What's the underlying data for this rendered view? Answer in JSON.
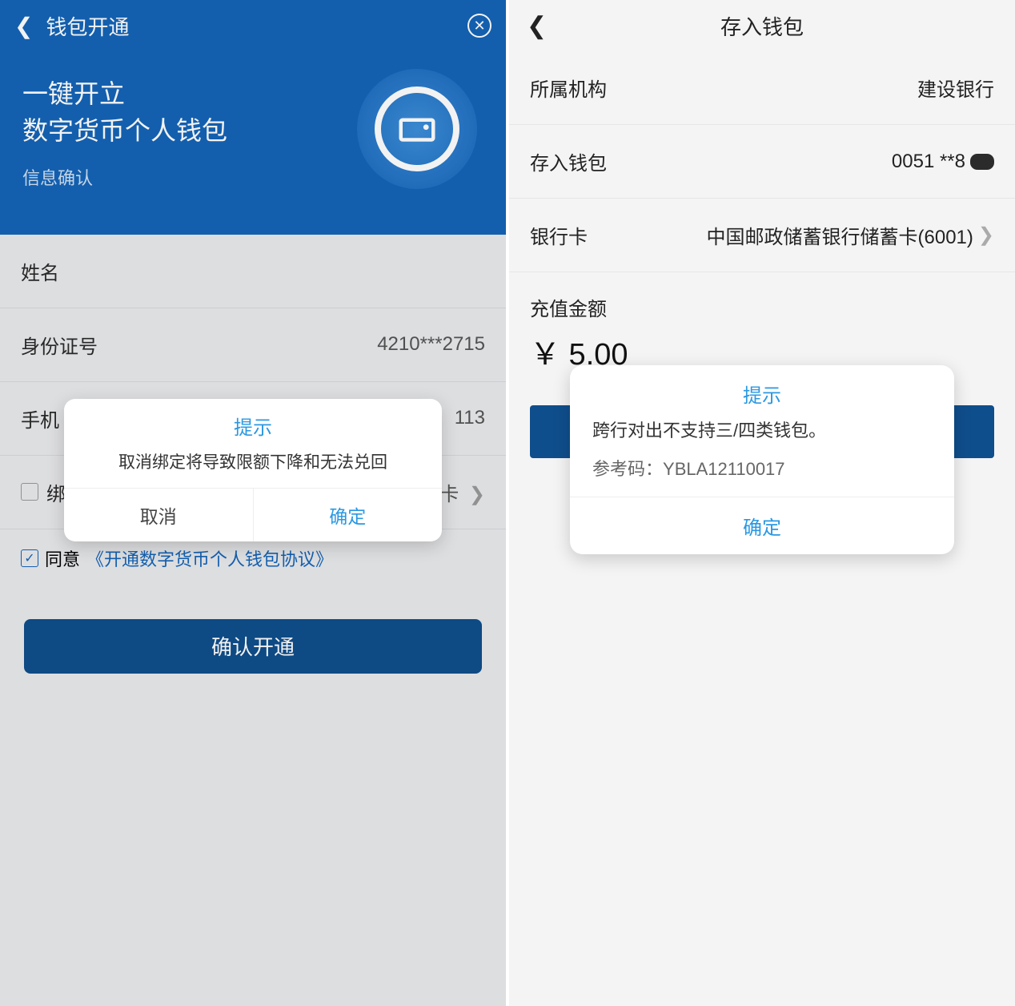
{
  "left": {
    "header": {
      "title": "钱包开通"
    },
    "hero": {
      "line1": "一键开立",
      "line2": "数字货币个人钱包",
      "sub": "信息确认"
    },
    "fields": {
      "name_label": "姓名",
      "id_label": "身份证号",
      "id_value": "4210***2715",
      "phone_label": "手机",
      "phone_value_suffix": "113",
      "bind_card_suffix": "卡",
      "checkbox_label": "同意",
      "agreement_link": "《开通数字货币个人钱包协议》"
    },
    "primary_button": "确认开通",
    "dialog": {
      "title": "提示",
      "message": "取消绑定将导致限额下降和无法兑回",
      "cancel": "取消",
      "ok": "确定"
    }
  },
  "right": {
    "header": {
      "title": "存入钱包"
    },
    "rows": {
      "org_label": "所属机构",
      "org_value": "建设银行",
      "wallet_label": "存入钱包",
      "wallet_value": "0051 **8",
      "bank_label": "银行卡",
      "bank_value": "中国邮政储蓄银行储蓄卡(6001)"
    },
    "amount_label": "充值金额",
    "amount_value": "￥ 5.00",
    "dialog": {
      "title": "提示",
      "message": "跨行对出不支持三/四类钱包。",
      "ref_label": "参考码：",
      "ref_code": "YBLA12110017",
      "ok": "确定"
    }
  }
}
